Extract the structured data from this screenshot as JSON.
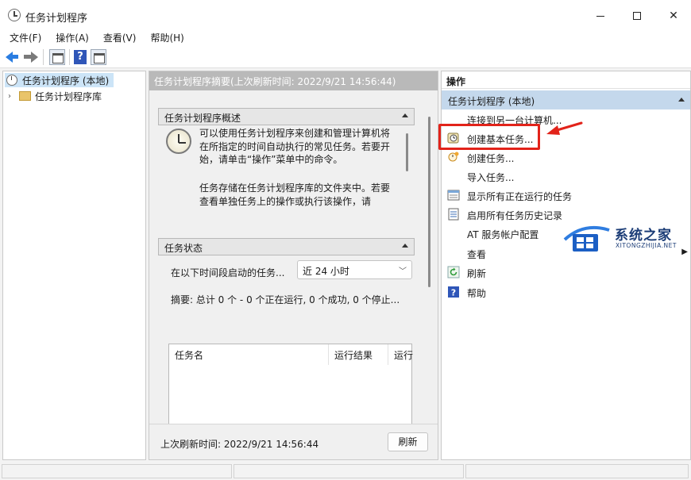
{
  "window": {
    "title": "任务计划程序",
    "minimize_glyph": "—",
    "maximize_glyph": "☐",
    "close_glyph": "✕"
  },
  "menu": [
    "文件(F)",
    "操作(A)",
    "查看(V)",
    "帮助(H)"
  ],
  "tree": {
    "root_label": "任务计划程序 (本地)",
    "library_label": "任务计划程序库",
    "expand_glyph": "›"
  },
  "middle": {
    "header": "任务计划程序摘要(上次刷新时间: 2022/9/21 14:56:44)",
    "overview": {
      "title": "任务计划程序概述",
      "para1": "可以使用任务计划程序来创建和管理计算机将在所指定的时间自动执行的常见任务。若要开始，请单击“操作”菜单中的命令。",
      "para2": "任务存储在任务计划程序库的文件夹中。若要查看单独任务上的操作或执行该操作，请"
    },
    "status": {
      "title": "任务状态",
      "period_label": "在以下时间段启动的任务...",
      "period_value": "近 24 小时",
      "summary": "摘要: 总计 0 个 - 0 个正在运行, 0 个成功, 0 个停止...",
      "columns": [
        "任务名",
        "运行结果",
        "运行"
      ]
    },
    "footer": {
      "last_refresh": "上次刷新时间: 2022/9/21 14:56:44",
      "refresh_button": "刷新"
    }
  },
  "actions": {
    "title": "操作",
    "group": "任务计划程序 (本地)",
    "items": [
      {
        "label": "连接到另一台计算机...",
        "icon": "none"
      },
      {
        "label": "创建基本任务...",
        "icon": "create-basic-task-icon"
      },
      {
        "label": "创建任务...",
        "icon": "create-task-icon"
      },
      {
        "label": "导入任务...",
        "icon": "none"
      },
      {
        "label": "显示所有正在运行的任务",
        "icon": "running-tasks-icon"
      },
      {
        "label": "启用所有任务历史记录",
        "icon": "history-icon"
      },
      {
        "label": "AT 服务帐户配置",
        "icon": "none"
      },
      {
        "label": "查看",
        "icon": "none"
      },
      {
        "label": "刷新",
        "icon": "refresh-icon"
      },
      {
        "label": "帮助",
        "icon": "help-icon"
      }
    ]
  },
  "watermark": {
    "title": "系统之家",
    "subtitle": "XITONGZHIJIA.NET"
  },
  "colors": {
    "highlight": "#e2231a",
    "selection": "#cce4f7",
    "group_header": "#c4d8ec"
  }
}
